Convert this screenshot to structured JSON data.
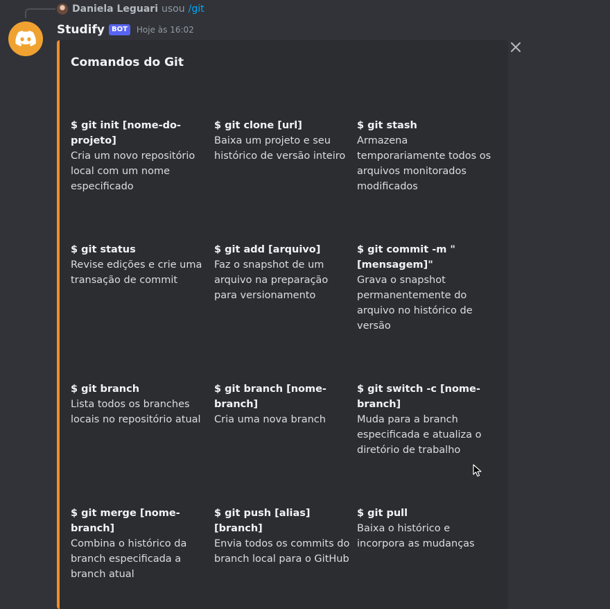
{
  "reply": {
    "user": "Daniela Leguari",
    "action_text": "usou",
    "command": "/git"
  },
  "message": {
    "bot_name": "Studify",
    "badge": "BOT",
    "timestamp": "Hoje às 16:02"
  },
  "embed": {
    "accent_color": "#f48c28",
    "title": "Comandos do Git",
    "fields": [
      {
        "name": "$ git init [nome-do-projeto]",
        "value": "Cria um novo repositório local com um nome especificado"
      },
      {
        "name": "$ git clone [url]",
        "value": "Baixa um projeto e seu histórico de versão inteiro"
      },
      {
        "name": "$ git stash",
        "value": "Armazena temporariamente todos os arquivos monitorados modificados"
      },
      {
        "name": "$ git status",
        "value": "Revise edições e crie uma transação de commit"
      },
      {
        "name": "$ git add [arquivo]",
        "value": "Faz o snapshot de um arquivo na preparação para versionamento"
      },
      {
        "name": "$ git commit -m \"[mensagem]\"",
        "value": "Grava o snapshot permanentemente do arquivo no histórico de versão"
      },
      {
        "name": "$ git branch",
        "value": "Lista todos os branches locais no repositório atual"
      },
      {
        "name": "$ git branch [nome-branch]",
        "value": "Cria uma nova branch"
      },
      {
        "name": "$ git switch -c [nome-branch]",
        "value": "Muda para a branch especificada e atualiza o diretório de trabalho"
      },
      {
        "name": "$ git merge [nome-branch]",
        "value": "Combina o histórico da branch especificada a branch atual"
      },
      {
        "name": "$ git push [alias] [branch]",
        "value": "Envia todos os commits do branch local para o GitHub"
      },
      {
        "name": "$ git pull",
        "value": "Baixa o histórico e incorpora as mudanças"
      }
    ]
  },
  "icons": {
    "avatar": "discord-logo-icon",
    "close": "close-icon",
    "cursor": "mouse-cursor-icon"
  },
  "colors": {
    "background": "#313338",
    "embed_background": "#2b2d31",
    "avatar_background": "#f0a231",
    "badge": "#5865f2",
    "command_link": "#00a8fc"
  }
}
